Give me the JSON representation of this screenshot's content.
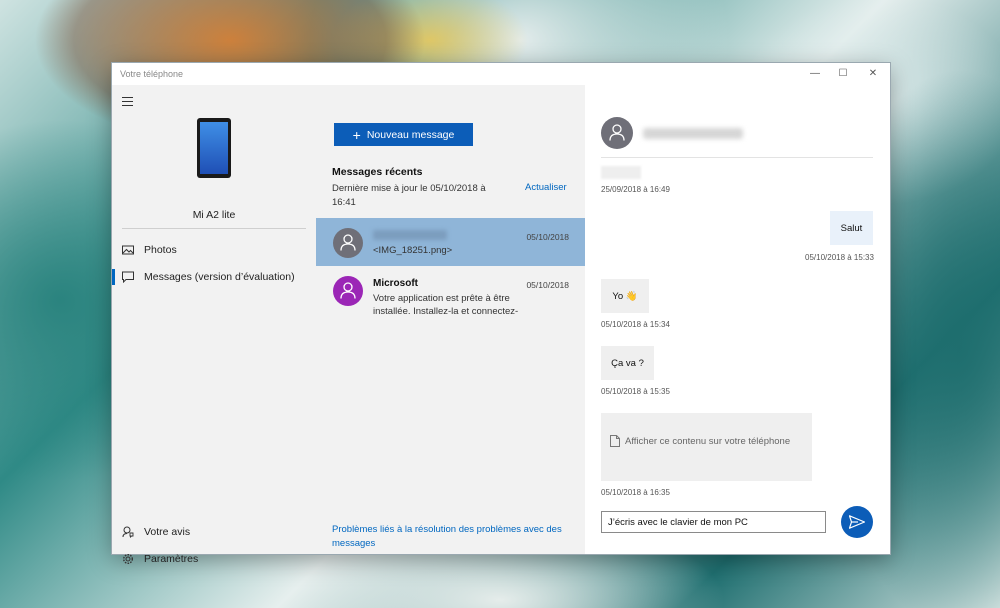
{
  "window": {
    "title": "Votre téléphone",
    "controls": {
      "minimize": "—",
      "maximize": "☐",
      "close": "✕"
    }
  },
  "nav": {
    "device_name": "Mi A2 lite",
    "items": [
      {
        "label": "Photos",
        "icon": "photos-icon",
        "active": false
      },
      {
        "label": "Messages (version d’évaluation)",
        "icon": "message-icon",
        "active": true
      }
    ],
    "bottom_items": [
      {
        "label": "Votre avis",
        "icon": "feedback-icon"
      },
      {
        "label": "Paramètres",
        "icon": "gear-icon"
      }
    ]
  },
  "messages_list": {
    "new_message_label": "Nouveau message",
    "recent_title": "Messages récents",
    "updated_text": "Dernière mise à jour le 05/10/2018 à 16:41",
    "refresh_label": "Actualiser",
    "conversations": [
      {
        "name": "",
        "name_blurred": true,
        "date": "05/10/2018",
        "preview": "<IMG_18251.png>",
        "selected": true,
        "avatar_color": "#6f6f78"
      },
      {
        "name": "Microsoft",
        "name_blurred": false,
        "date": "05/10/2018",
        "preview": "Votre application est prête à être installée. Installez-la et connectez-",
        "selected": false,
        "avatar_color": "#9b26b6"
      }
    ],
    "help_link": "Problèmes liés à la résolution des problèmes avec des messages"
  },
  "chat": {
    "messages": [
      {
        "timestamp": "25/09/2018 à 16:49"
      },
      {
        "direction": "out",
        "text": "Salut",
        "timestamp": "05/10/2018 à 15:33"
      },
      {
        "direction": "in",
        "text": "Yo 👋",
        "timestamp": "05/10/2018 à 15:34"
      },
      {
        "direction": "in",
        "text": "Ça va ?",
        "timestamp": "05/10/2018 à 15:35"
      },
      {
        "direction": "in",
        "attachment_text": "Afficher ce contenu sur votre téléphone",
        "timestamp": "05/10/2018 à 16:35"
      }
    ],
    "compose_value": "J’écris avec le clavier de mon PC"
  },
  "colors": {
    "accent": "#0c5db8",
    "link": "#0067c0",
    "selected_row": "#8fb5d8",
    "microsoft_avatar": "#9b26b6"
  }
}
